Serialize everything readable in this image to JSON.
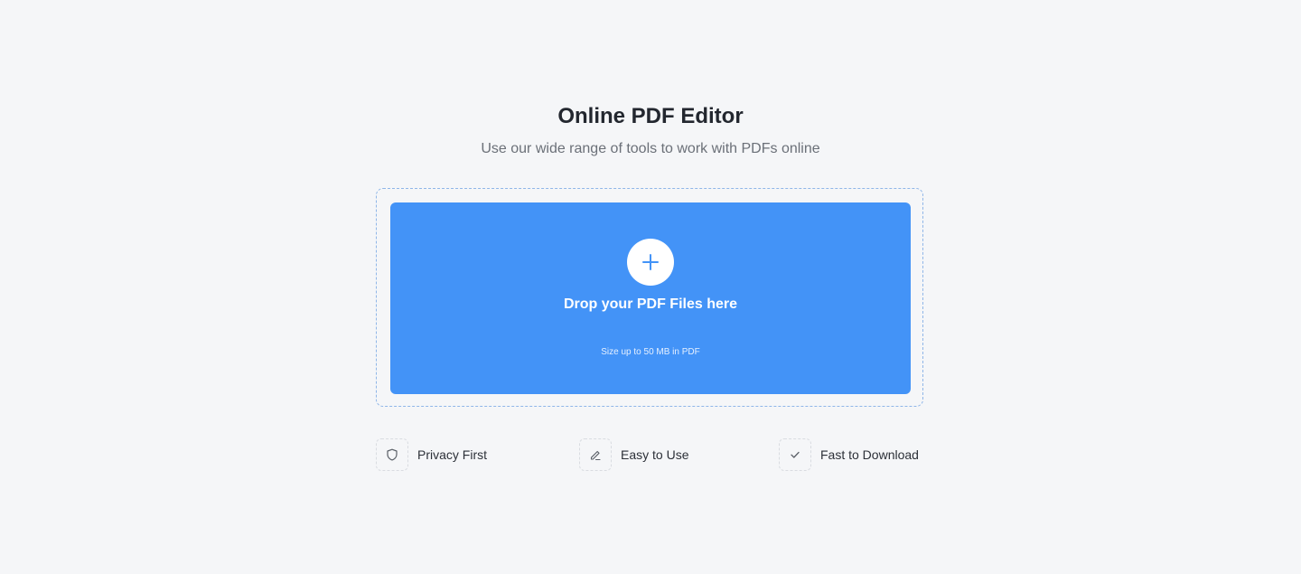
{
  "header": {
    "title": "Online PDF Editor",
    "subtitle": "Use our wide range of tools to work with PDFs online"
  },
  "upload": {
    "label": "Drop your PDF Files here",
    "hint": "Size up to 50 MB in PDF",
    "add_icon": "plus-icon",
    "accent_color": "#4393f7"
  },
  "features": [
    {
      "label": "Privacy First",
      "icon": "shield-icon"
    },
    {
      "label": "Easy to Use",
      "icon": "pencil-icon"
    },
    {
      "label": "Fast to Download",
      "icon": "check-icon"
    }
  ]
}
